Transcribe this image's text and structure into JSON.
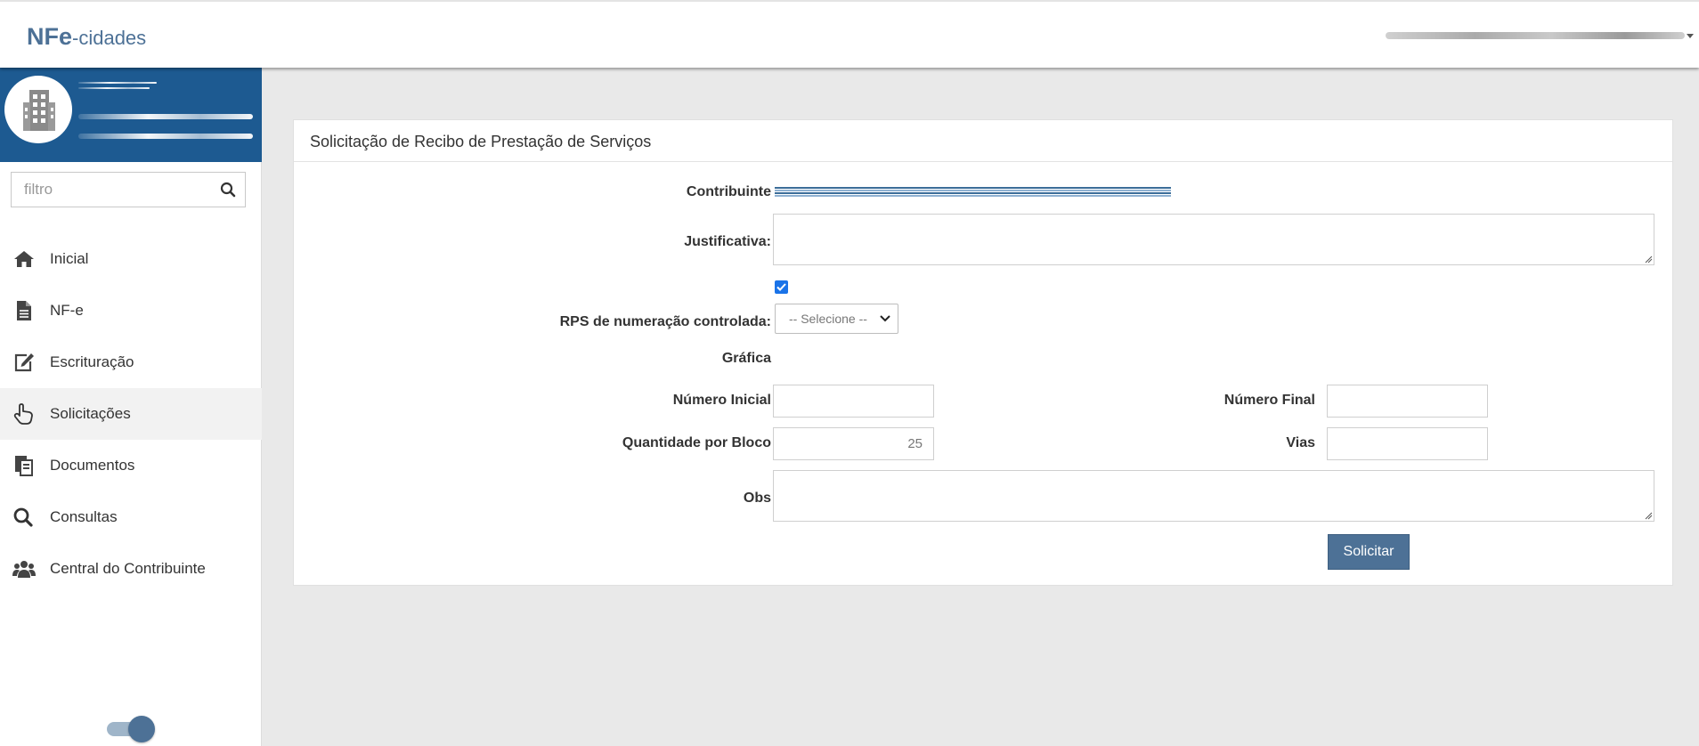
{
  "header": {
    "brand_bold": "NFe",
    "brand_rest": "-cidades",
    "user_menu_icon": "chevron-down-icon"
  },
  "sidebar": {
    "profile_icon": "building-icon",
    "filter": {
      "placeholder": "filtro",
      "icon": "search-icon"
    },
    "items": [
      {
        "label": "Inicial",
        "icon": "home-icon",
        "active": false
      },
      {
        "label": "NF-e",
        "icon": "file-text-icon",
        "active": false
      },
      {
        "label": "Escrituração",
        "icon": "edit-icon",
        "active": false
      },
      {
        "label": "Solicitações",
        "icon": "hand-pointer-icon",
        "active": true
      },
      {
        "label": "Documentos",
        "icon": "documents-icon",
        "active": false
      },
      {
        "label": "Consultas",
        "icon": "search-icon",
        "active": false
      },
      {
        "label": "Central do Contribuinte",
        "icon": "users-icon",
        "active": false
      }
    ],
    "toggle_on": true
  },
  "panel": {
    "title": "Solicitação de Recibo de Prestação de Serviços",
    "fields": {
      "contribuinte": "Contribuinte",
      "justificativa": "Justificativa:",
      "rps_controlada": "RPS de numeração controlada:",
      "grafica": "Gráfica",
      "numero_inicial": "Número Inicial",
      "numero_final": "Número Final",
      "quantidade_bloco": "Quantidade por Bloco",
      "vias": "Vias",
      "obs": "Obs"
    },
    "values": {
      "rps_checked": true,
      "grafica_selected": "-- Selecione --",
      "quantidade_bloco": "25",
      "justificativa": "",
      "numero_inicial": "",
      "numero_final": "",
      "vias": "",
      "obs": ""
    },
    "submit_label": "Solicitar"
  },
  "colors": {
    "primary": "#4d7196",
    "sidebar_header": "#1d5a91",
    "background": "#e9e9e9",
    "checkbox": "#1a73e8"
  }
}
